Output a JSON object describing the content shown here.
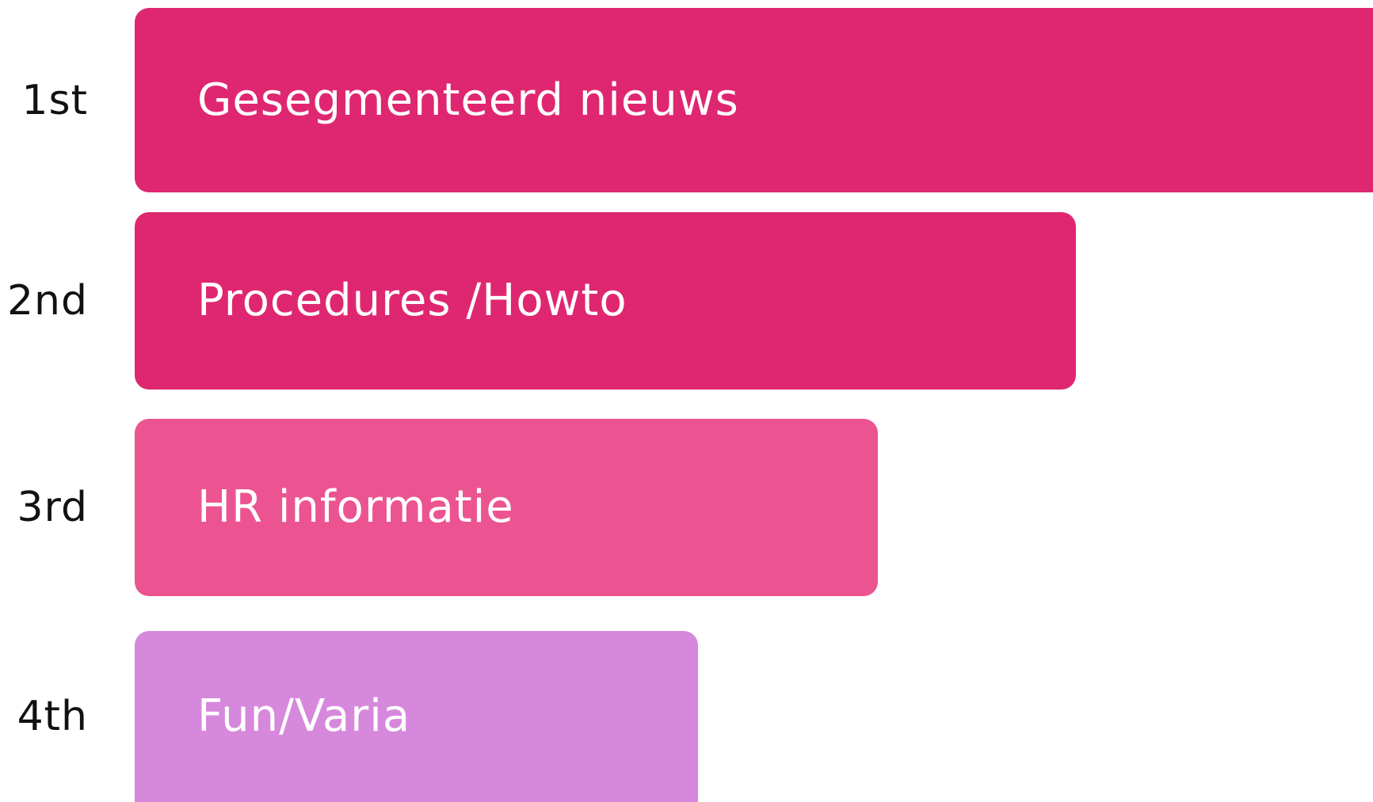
{
  "chart_data": {
    "type": "bar",
    "orientation": "horizontal",
    "categories": [
      "Gesegmenteerd nieuws",
      "Procedures /Howto",
      "HR informatie",
      "Fun/Varia"
    ],
    "ranks": [
      "1st",
      "2nd",
      "3rd",
      "4th"
    ],
    "values": [
      100,
      76,
      60,
      45.5
    ],
    "colors": [
      "#df2771",
      "#df2771",
      "#ec5491",
      "#d688dc"
    ],
    "xlim": [
      0,
      100
    ],
    "grid": false,
    "legend": "none"
  }
}
